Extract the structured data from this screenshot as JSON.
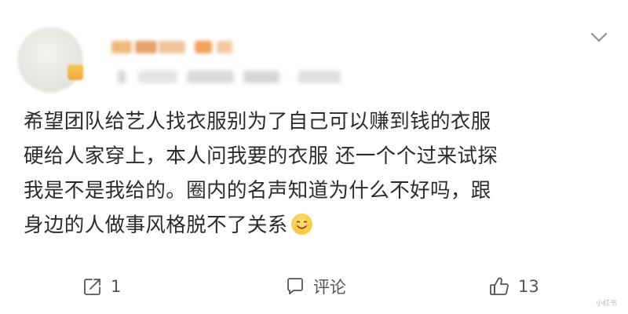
{
  "post": {
    "author": {
      "name_redacted": true
    },
    "content_lines": [
      "希望团队给艺人找衣服别为了自己可以赚到钱的衣服",
      "硬给人家穿上，本人问我要的衣服 还一个个过来试探",
      "我是不是我给的。圈内的名声知道为什么不好吗，跟",
      "身边的人做事风格脱不了关系"
    ],
    "emoji": "smiling-face-icon"
  },
  "actions": {
    "repost": {
      "icon": "share-icon",
      "count": "1"
    },
    "comment": {
      "icon": "comment-icon",
      "label": "评论"
    },
    "like": {
      "icon": "thumbs-up-icon",
      "count": "13"
    }
  },
  "menu": {
    "icon": "chevron-down-icon"
  },
  "watermark": "小红书",
  "colors": {
    "text": "#2b2b2b",
    "secondary": "#555555",
    "background": "#ffffff",
    "emoji_yellow": "#fbc93c"
  }
}
